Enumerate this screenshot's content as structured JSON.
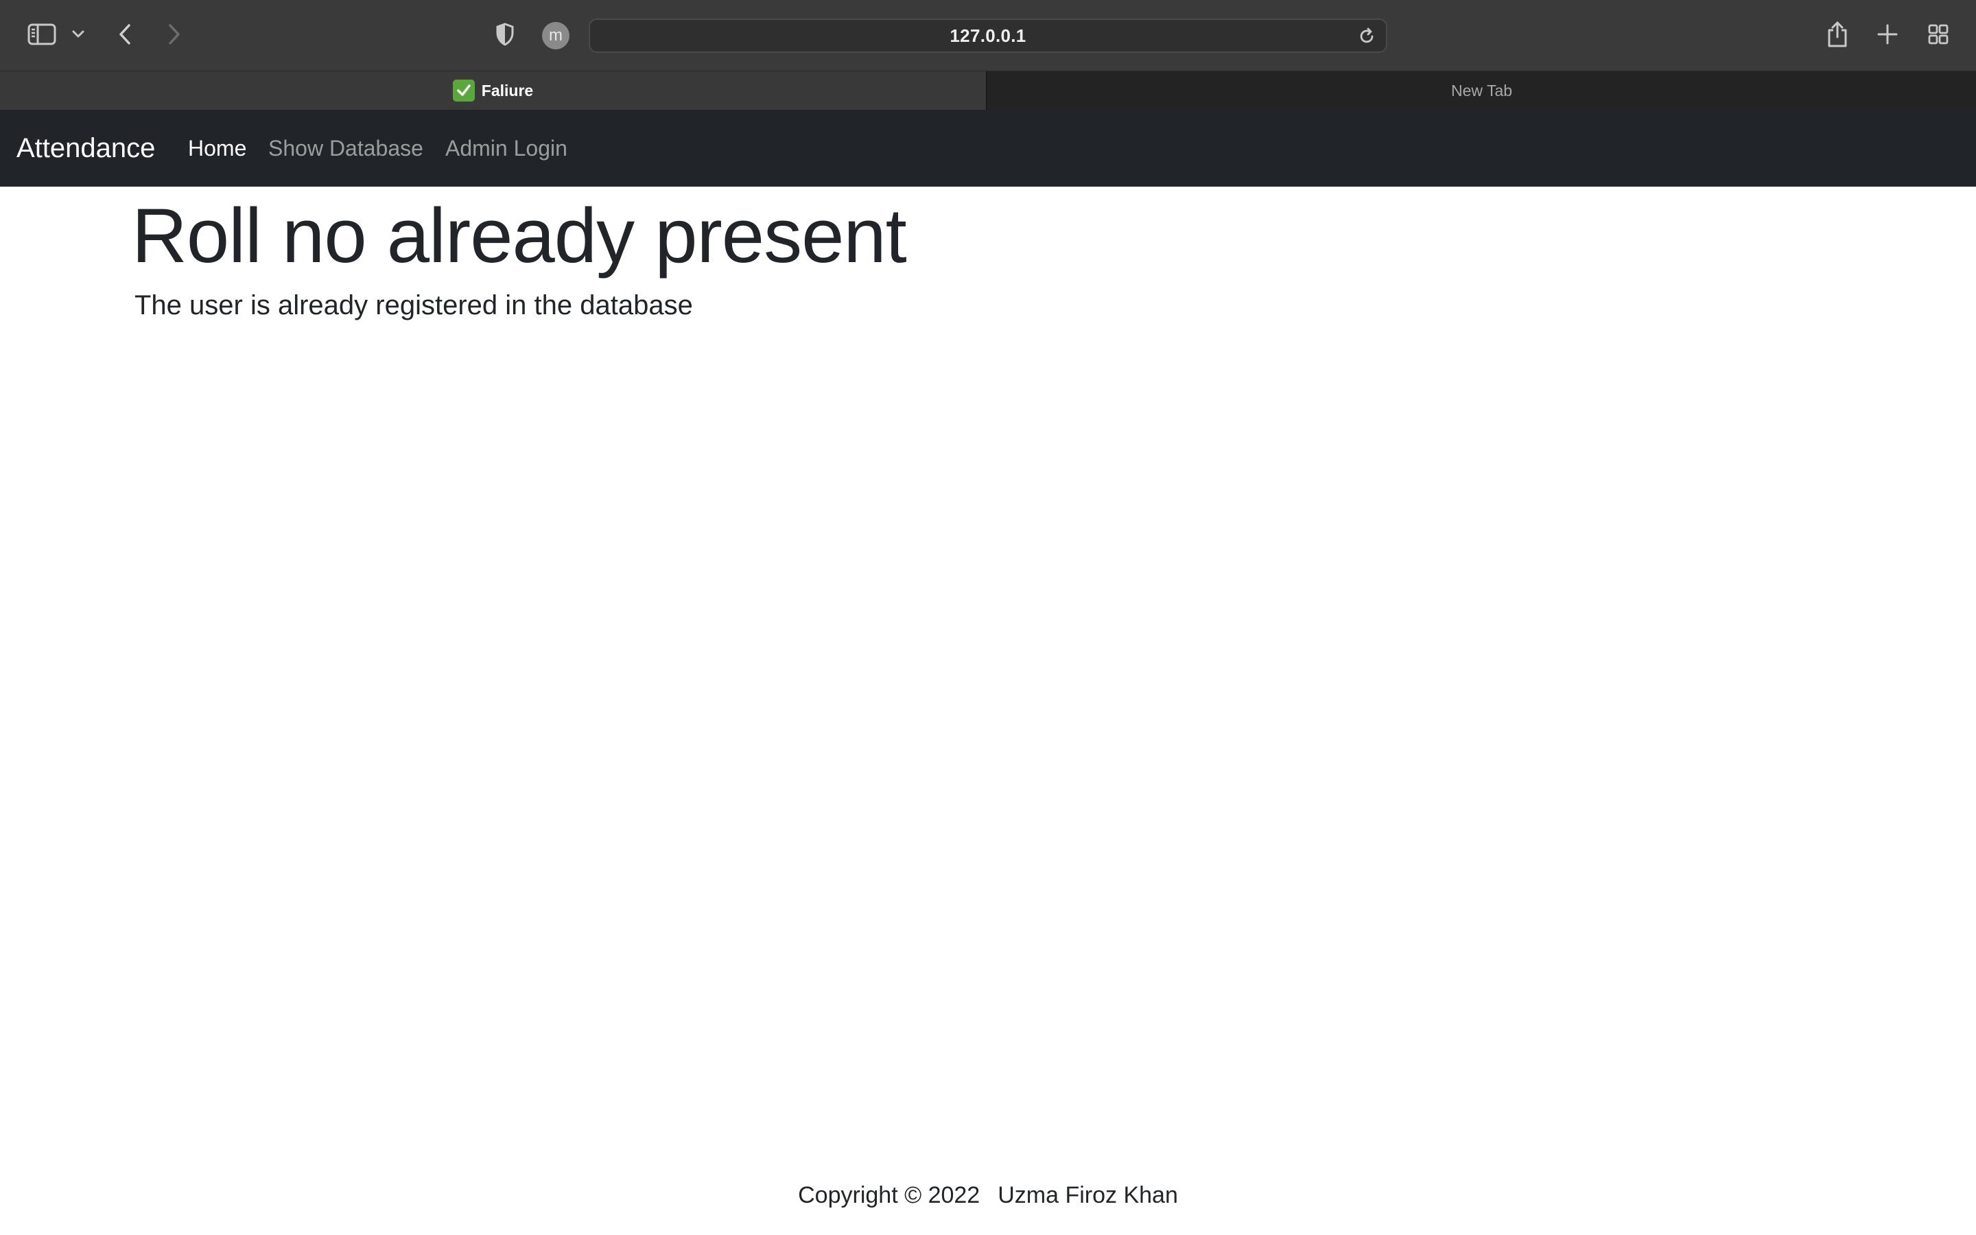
{
  "browser": {
    "address": "127.0.0.1",
    "profile_initial": "m",
    "tabs": [
      {
        "label": "Faliure",
        "active": true,
        "favicon": "check-icon"
      },
      {
        "label": "New Tab",
        "active": false
      }
    ],
    "icons": {
      "sidebar": "sidebar-icon",
      "chevron": "chevron-down-icon",
      "back": "back-icon",
      "forward": "forward-icon",
      "shield": "shield-icon",
      "reload": "reload-icon",
      "share": "share-icon",
      "new_tab": "plus-icon",
      "tab_overview": "grid-icon"
    }
  },
  "navbar": {
    "brand": "Attendance",
    "links": [
      {
        "label": "Home",
        "active": true
      },
      {
        "label": "Show Database",
        "active": false
      },
      {
        "label": "Admin Login",
        "active": false
      }
    ]
  },
  "main": {
    "title": "Roll no already present",
    "message": "The user is already registered in the database"
  },
  "footer": {
    "copyright": "Copyright © 2022",
    "author": "Uzma Firoz Khan"
  },
  "colors": {
    "toolbar": "#3a3a3a",
    "navbar": "#212529",
    "favicon": "#5aa83b"
  }
}
